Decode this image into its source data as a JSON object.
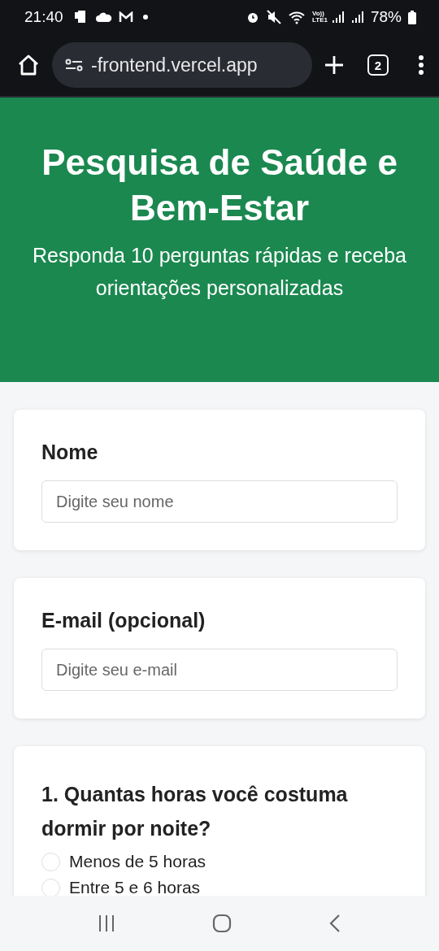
{
  "status_bar": {
    "time": "21:40",
    "network_label": "Vo)) LTE1",
    "battery": "78%"
  },
  "browser": {
    "url": "-frontend.vercel.app",
    "tab_count": "2"
  },
  "header": {
    "title": "Pesquisa de Saúde e Bem-Estar",
    "subtitle": "Responda 10 perguntas rápidas e receba orientações personalizadas"
  },
  "fields": [
    {
      "label": "Nome",
      "placeholder": "Digite seu nome"
    },
    {
      "label": "E-mail (opcional)",
      "placeholder": "Digite seu e-mail"
    }
  ],
  "questions": [
    {
      "title": "1. Quantas horas você costuma dormir por noite?",
      "options": [
        {
          "label": "Menos de 5 horas",
          "selected": false
        },
        {
          "label": "Entre 5 e 6 horas",
          "selected": false
        }
      ]
    }
  ]
}
